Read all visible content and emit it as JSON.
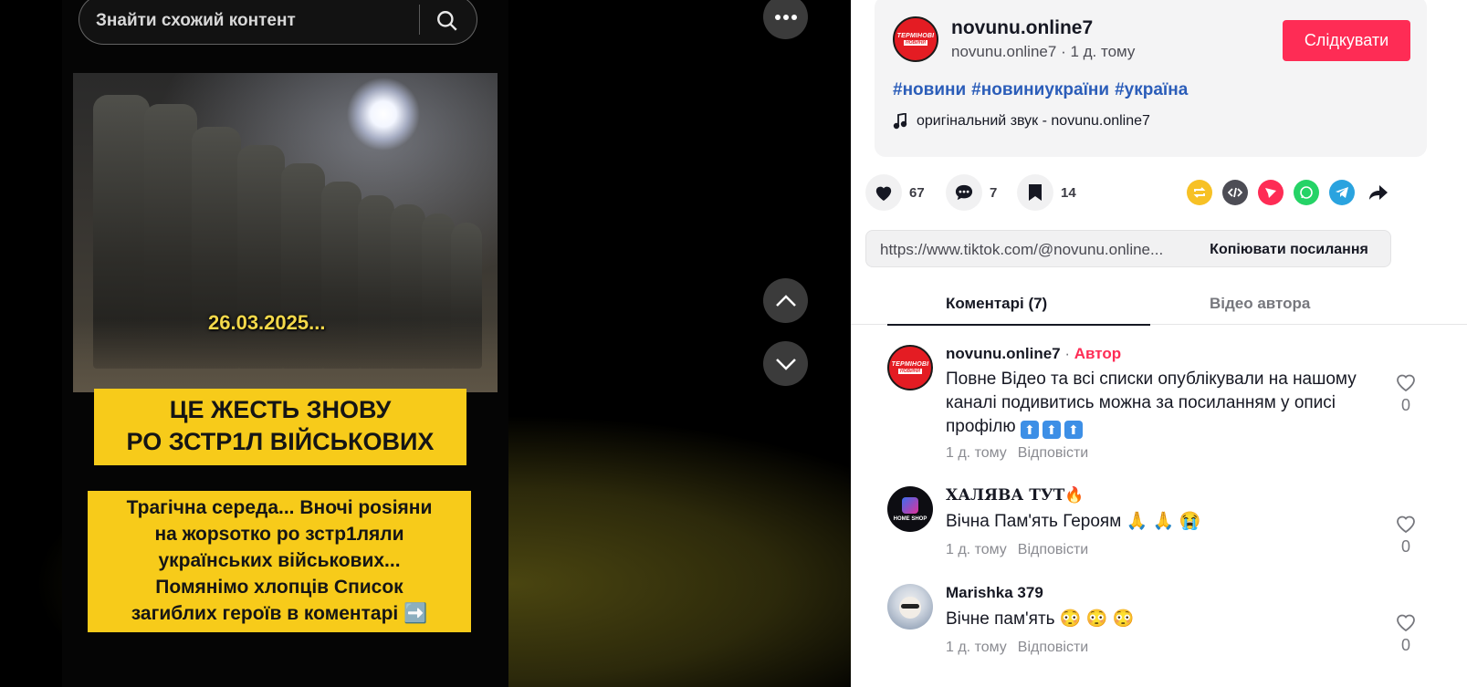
{
  "search": {
    "placeholder": "Знайти схожий контент"
  },
  "video": {
    "date_text": "26.03.2025...",
    "caption_box1": [
      "ЦЕ ЖЕСТЬ ЗНОВУ",
      "РО  ЗСТР1Л ВІЙСЬКОВИХ"
    ],
    "caption_box2": [
      "Трагічна середа... Вночі posiяни",
      "на жорsотко ро  зстр1ляли",
      "українських військових...",
      "Помянімо хлопців Список",
      "загиблих героїв в коментарі ➡️"
    ]
  },
  "author": {
    "name": "novunu.online7",
    "handle": "novunu.online7",
    "time": "1 д. тому",
    "avatar_text": [
      "ТЕРМІНОВІ",
      "НОВИНИ"
    ],
    "follow_label": "Слідкувати"
  },
  "hashtags": [
    "#новини",
    "#новиниукраїни",
    "#україна"
  ],
  "music": {
    "label": "оригінальний звук - novunu.online7"
  },
  "actions": {
    "likes": "67",
    "comments": "7",
    "saves": "14"
  },
  "link": {
    "url": "https://www.tiktok.com/@novunu.online...",
    "copy_label": "Копіювати посилання"
  },
  "tabs": [
    {
      "label": "Коментарі (7)",
      "active": true
    },
    {
      "label": "Відео автора",
      "active": false
    }
  ],
  "comments": [
    {
      "user": "novunu.online7",
      "author_tag": "Автор",
      "text": "Повне Відео та всі списки опублікували на нашому каналі подивитись можна за посиланням у описі профілю",
      "emojis": [
        "⬆",
        "⬆",
        "⬆"
      ],
      "time": "1 д. тому",
      "reply": "Відповісти",
      "likes": "0"
    },
    {
      "user": "ХАЛЯВА ТУТ🔥",
      "text": "Вічна Пам'ять Героям",
      "emojis": [
        "🙏",
        "🙏",
        "😭"
      ],
      "time": "1 д. тому",
      "reply": "Відповісти",
      "likes": "0",
      "avatar_text": "HOME SHOP"
    },
    {
      "user": "Marishka 379",
      "text": "Вічне пам'ять",
      "emojis": [
        "😳",
        "😳",
        "😳"
      ],
      "time": "1 д. тому",
      "reply": "Відповісти",
      "likes": "0"
    }
  ],
  "colors": {
    "accent": "#fe2c55",
    "hashtag": "#2b5db9",
    "caption_bg": "#f7cb1a",
    "video_date": "#f3d84a"
  }
}
